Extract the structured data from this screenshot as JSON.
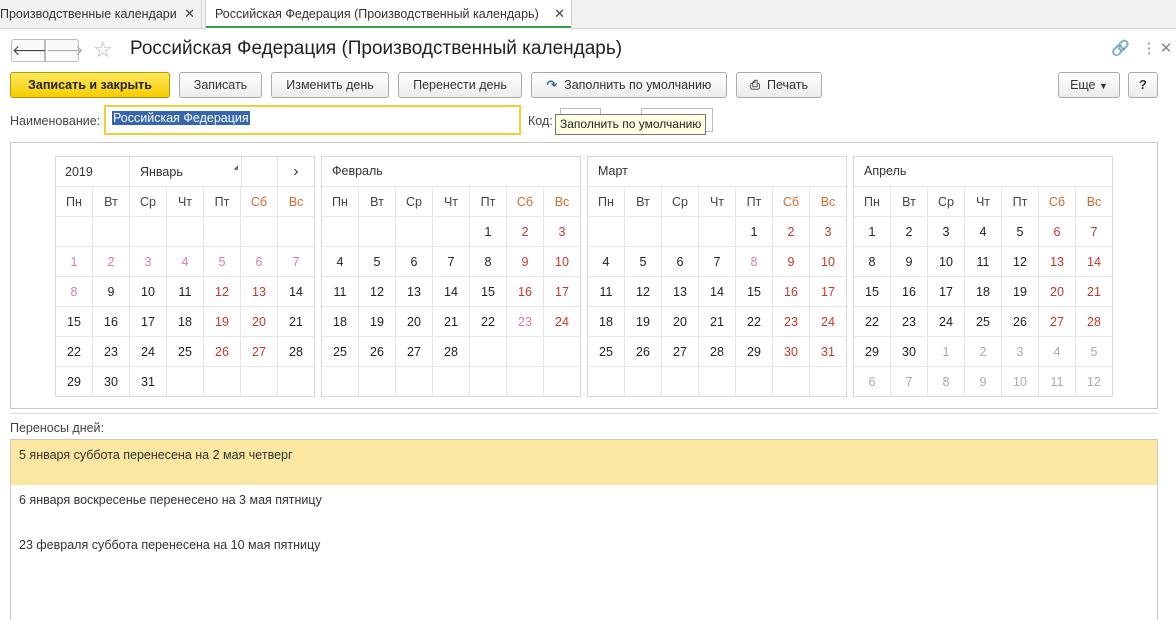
{
  "tabs": [
    {
      "label": "Производственные календари"
    },
    {
      "label": "Российская Федерация (Производственный календарь)"
    }
  ],
  "header": {
    "title": "Российская Федерация (Производственный календарь)"
  },
  "toolbar": {
    "save_close": "Записать и закрыть",
    "save": "Записать",
    "change_day": "Изменить день",
    "move_day": "Перенести день",
    "fill_default": "Заполнить по умолчанию",
    "print": "Печать",
    "more": "Еще",
    "help": "?"
  },
  "form": {
    "name_label": "Наименование:",
    "name_value": "Российская Федерация",
    "code_label": "Код:",
    "tooltip": "Заполнить по умолчанию"
  },
  "calendar": {
    "year": "2019",
    "weekday_headers": [
      "Пн",
      "Вт",
      "Ср",
      "Чт",
      "Пт",
      "Сб",
      "Вс"
    ],
    "months": [
      {
        "name": "Январь",
        "days": [
          [
            "",
            "n"
          ],
          [
            "",
            "n"
          ],
          [
            "",
            "n"
          ],
          [
            "",
            "n"
          ],
          [
            "",
            "n"
          ],
          [
            "",
            "n"
          ],
          [
            "",
            "n"
          ],
          [
            "1",
            "p"
          ],
          [
            "2",
            "p"
          ],
          [
            "3",
            "p"
          ],
          [
            "4",
            "p"
          ],
          [
            "5",
            "p"
          ],
          [
            "6",
            "p"
          ],
          [
            "7",
            "p"
          ],
          [
            "8",
            "p"
          ],
          [
            "9",
            "n"
          ],
          [
            "10",
            "n"
          ],
          [
            "11",
            "n"
          ],
          [
            "12",
            "h"
          ],
          [
            "13",
            "h"
          ],
          [
            "14",
            "n"
          ],
          [
            "15",
            "n"
          ],
          [
            "16",
            "n"
          ],
          [
            "17",
            "n"
          ],
          [
            "18",
            "n"
          ],
          [
            "19",
            "h"
          ],
          [
            "20",
            "h"
          ],
          [
            "21",
            "n"
          ],
          [
            "22",
            "n"
          ],
          [
            "23",
            "n"
          ],
          [
            "24",
            "n"
          ],
          [
            "25",
            "n"
          ],
          [
            "26",
            "h"
          ],
          [
            "27",
            "h"
          ],
          [
            "28",
            "n"
          ],
          [
            "29",
            "n"
          ],
          [
            "30",
            "n"
          ],
          [
            "31",
            "n"
          ]
        ]
      },
      {
        "name": "Февраль",
        "days": [
          [
            "",
            "n"
          ],
          [
            "",
            "n"
          ],
          [
            "",
            "n"
          ],
          [
            "",
            "n"
          ],
          [
            "1",
            "n"
          ],
          [
            "2",
            "h"
          ],
          [
            "3",
            "h"
          ],
          [
            "4",
            "n"
          ],
          [
            "5",
            "n"
          ],
          [
            "6",
            "n"
          ],
          [
            "7",
            "n"
          ],
          [
            "8",
            "n"
          ],
          [
            "9",
            "h"
          ],
          [
            "10",
            "h"
          ],
          [
            "11",
            "n"
          ],
          [
            "12",
            "n"
          ],
          [
            "13",
            "n"
          ],
          [
            "14",
            "n"
          ],
          [
            "15",
            "n"
          ],
          [
            "16",
            "h"
          ],
          [
            "17",
            "h"
          ],
          [
            "18",
            "n"
          ],
          [
            "19",
            "n"
          ],
          [
            "20",
            "n"
          ],
          [
            "21",
            "n"
          ],
          [
            "22",
            "n"
          ],
          [
            "23",
            "p"
          ],
          [
            "24",
            "h"
          ],
          [
            "25",
            "n"
          ],
          [
            "26",
            "n"
          ],
          [
            "27",
            "n"
          ],
          [
            "28",
            "n"
          ]
        ]
      },
      {
        "name": "Март",
        "days": [
          [
            "",
            "n"
          ],
          [
            "",
            "n"
          ],
          [
            "",
            "n"
          ],
          [
            "",
            "n"
          ],
          [
            "1",
            "n"
          ],
          [
            "2",
            "h"
          ],
          [
            "3",
            "h"
          ],
          [
            "4",
            "n"
          ],
          [
            "5",
            "n"
          ],
          [
            "6",
            "n"
          ],
          [
            "7",
            "n"
          ],
          [
            "8",
            "p"
          ],
          [
            "9",
            "h"
          ],
          [
            "10",
            "h"
          ],
          [
            "11",
            "n"
          ],
          [
            "12",
            "n"
          ],
          [
            "13",
            "n"
          ],
          [
            "14",
            "n"
          ],
          [
            "15",
            "n"
          ],
          [
            "16",
            "h"
          ],
          [
            "17",
            "h"
          ],
          [
            "18",
            "n"
          ],
          [
            "19",
            "n"
          ],
          [
            "20",
            "n"
          ],
          [
            "21",
            "n"
          ],
          [
            "22",
            "n"
          ],
          [
            "23",
            "h"
          ],
          [
            "24",
            "h"
          ],
          [
            "25",
            "n"
          ],
          [
            "26",
            "n"
          ],
          [
            "27",
            "n"
          ],
          [
            "28",
            "n"
          ],
          [
            "29",
            "n"
          ],
          [
            "30",
            "h"
          ],
          [
            "31",
            "h"
          ]
        ]
      },
      {
        "name": "Апрель",
        "days": [
          [
            "1",
            "n"
          ],
          [
            "2",
            "n"
          ],
          [
            "3",
            "n"
          ],
          [
            "4",
            "n"
          ],
          [
            "5",
            "n"
          ],
          [
            "6",
            "h"
          ],
          [
            "7",
            "h"
          ],
          [
            "8",
            "n"
          ],
          [
            "9",
            "n"
          ],
          [
            "10",
            "n"
          ],
          [
            "11",
            "n"
          ],
          [
            "12",
            "n"
          ],
          [
            "13",
            "h"
          ],
          [
            "14",
            "h"
          ],
          [
            "15",
            "n"
          ],
          [
            "16",
            "n"
          ],
          [
            "17",
            "n"
          ],
          [
            "18",
            "n"
          ],
          [
            "19",
            "n"
          ],
          [
            "20",
            "h"
          ],
          [
            "21",
            "h"
          ],
          [
            "22",
            "n"
          ],
          [
            "23",
            "n"
          ],
          [
            "24",
            "n"
          ],
          [
            "25",
            "n"
          ],
          [
            "26",
            "n"
          ],
          [
            "27",
            "h"
          ],
          [
            "28",
            "h"
          ],
          [
            "29",
            "n"
          ],
          [
            "30",
            "n"
          ],
          [
            "1",
            "g"
          ],
          [
            "2",
            "g"
          ],
          [
            "3",
            "g"
          ],
          [
            "4",
            "g"
          ],
          [
            "5",
            "g"
          ],
          [
            "6",
            "g"
          ],
          [
            "7",
            "g"
          ],
          [
            "8",
            "g"
          ],
          [
            "9",
            "g"
          ],
          [
            "10",
            "g"
          ],
          [
            "11",
            "g"
          ],
          [
            "12",
            "g"
          ]
        ]
      }
    ]
  },
  "transfers": {
    "label": "Переносы дней:",
    "items": [
      "5 января суббота перенесена на 2 мая четверг",
      "6 января воскресенье перенесено на 3 мая пятницу",
      "23 февраля суббота перенесена на 10 мая пятницу"
    ]
  },
  "colors": {
    "primary_button": "#f6cd00",
    "holiday": "#c0392b",
    "pre_holiday": "#d77bb5",
    "selection": "#fbe7a1",
    "active_tab": "#3a9a4a"
  }
}
